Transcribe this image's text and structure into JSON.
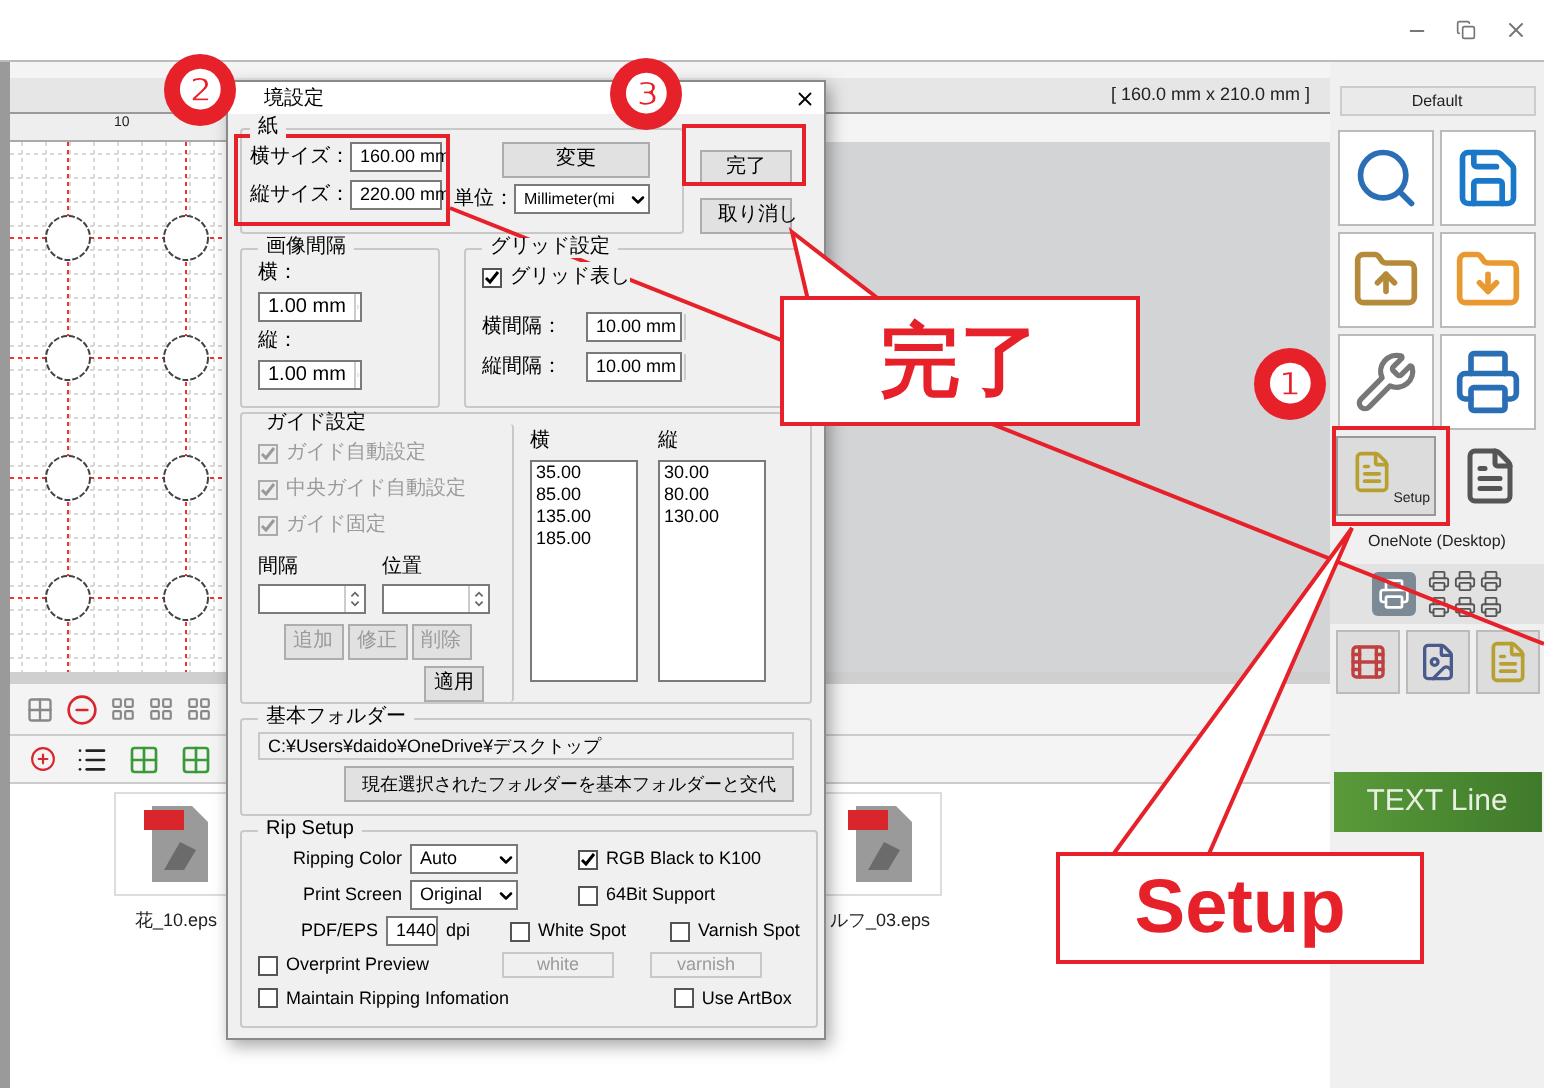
{
  "canvas": {
    "ruler_label": "10",
    "page_size": "[ 160.0 mm x 210.0 mm ]"
  },
  "files": [
    {
      "name": "花_10.eps"
    },
    {
      "name": "ルフ_03.eps"
    }
  ],
  "right_panel": {
    "preset": "Default",
    "setup_label": "Setup",
    "printer": "OneNote (Desktop)",
    "text_line": "TEXT Line"
  },
  "dialog": {
    "title": "境設定",
    "paper": {
      "title": "紙",
      "width_label": "横サイズ：",
      "width_value": "160.00 mm",
      "height_label": "縦サイズ：",
      "height_value": "220.00 mm",
      "change_button": "変更",
      "unit_label": "単位：",
      "unit_value": "Millimeter(mi"
    },
    "ok_button": "完了",
    "cancel_button": "取り消し",
    "spacing": {
      "title": "画像間隔",
      "h_label": "横：",
      "h_value": "1.00 mm",
      "v_label": "縦：",
      "v_value": "1.00 mm"
    },
    "grid": {
      "title": "グリッド設定",
      "show_label": "グリッド表し",
      "show_checked": true,
      "h_label": "横間隔：",
      "h_value": "10.00 mm",
      "v_label": "縦間隔：",
      "v_value": "10.00 mm"
    },
    "guide": {
      "title": "ガイド設定",
      "checks": [
        {
          "label": "ガイド自動設定",
          "checked": true,
          "disabled": true
        },
        {
          "label": "中央ガイド自動設定",
          "checked": true,
          "disabled": true
        },
        {
          "label": "ガイド固定",
          "checked": true,
          "disabled": true
        }
      ],
      "interval_label": "間隔",
      "position_label": "位置",
      "buttons": [
        {
          "label": "追加",
          "disabled": true
        },
        {
          "label": "修正",
          "disabled": true
        },
        {
          "label": "削除",
          "disabled": true
        },
        {
          "label": "適用",
          "disabled": false
        }
      ],
      "h_header": "横",
      "h_values": [
        "35.00",
        "85.00",
        "135.00",
        "185.00"
      ],
      "v_header": "縦",
      "v_values": [
        "30.00",
        "80.00",
        "130.00"
      ]
    },
    "folder": {
      "title": "基本フォルダー",
      "path": "C:¥Users¥daido¥OneDrive¥デスクトップ",
      "button": "現在選択されたフォルダーを基本フォルダーと交代"
    },
    "rip": {
      "title": "Rip Setup",
      "color_label": "Ripping Color",
      "color_value": "Auto",
      "screen_label": "Print Screen",
      "screen_value": "Original",
      "pdf_label": "PDF/EPS",
      "dpi_value": "1440",
      "dpi_unit": "dpi",
      "checks": [
        {
          "label": "RGB Black to K100",
          "checked": true
        },
        {
          "label": "64Bit Support",
          "checked": false
        },
        {
          "label": "White Spot",
          "checked": false
        },
        {
          "label": "Varnish Spot",
          "checked": false
        },
        {
          "label": "Overprint Preview",
          "checked": false
        },
        {
          "label": "Maintain Ripping Infomation",
          "checked": false
        },
        {
          "label": "Use ArtBox",
          "checked": false
        }
      ],
      "white_field": "white",
      "varnish_field": "varnish"
    }
  },
  "annotations": {
    "markers": [
      "❶",
      "❷",
      "❸"
    ],
    "callouts": [
      "完了",
      "Setup"
    ]
  }
}
